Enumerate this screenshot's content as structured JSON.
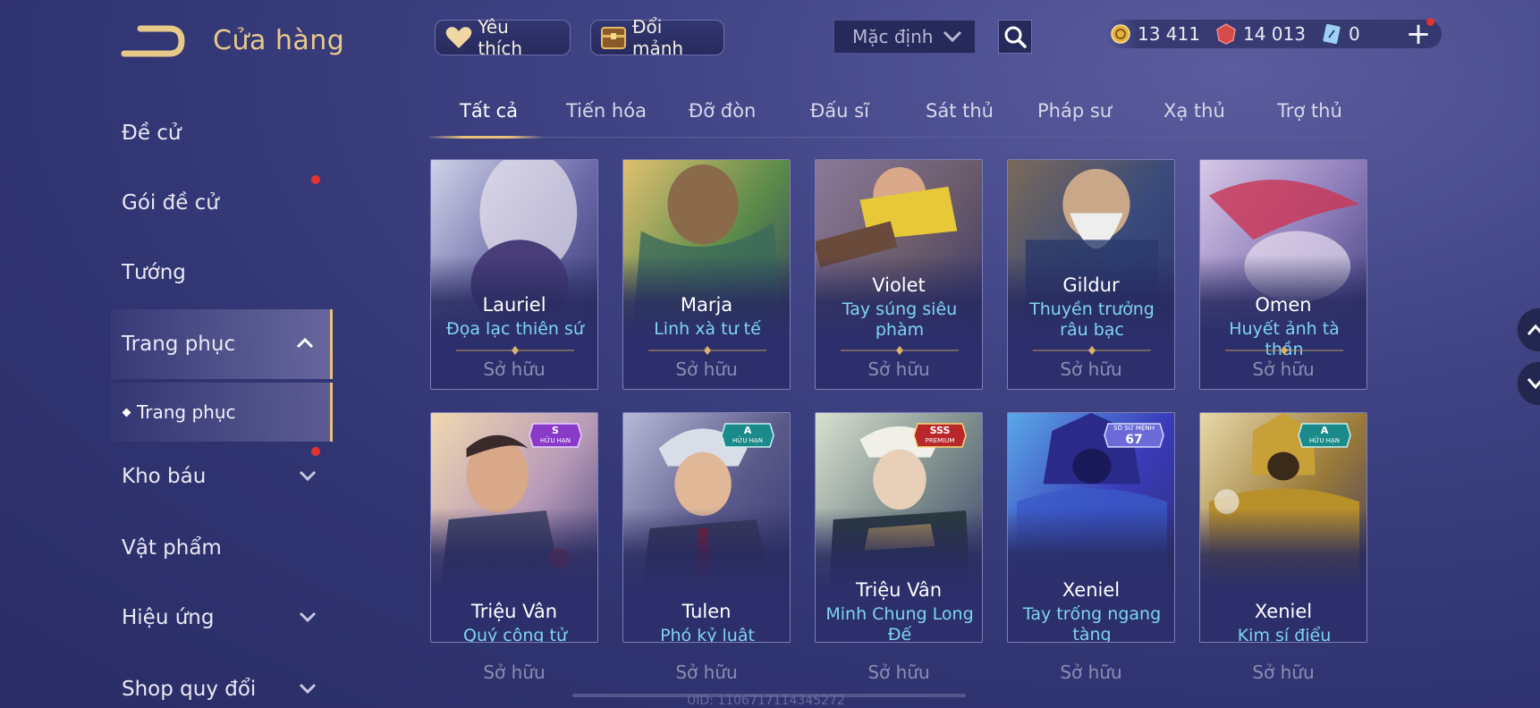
{
  "header": {
    "title": "Cửa hàng",
    "favorite_label": "Yêu thích",
    "exchange_label": "Đổi mảnh",
    "sort": {
      "selected": "Mặc định"
    },
    "currencies": [
      {
        "icon": "gold-coin-icon",
        "value": "13 411"
      },
      {
        "icon": "ruby-gem-icon",
        "value": "14 013"
      },
      {
        "icon": "voucher-icon",
        "value": "0"
      }
    ],
    "add_label": "+"
  },
  "sidebar": {
    "items": [
      {
        "label": "Đề cử"
      },
      {
        "label": "Gói đề cử"
      },
      {
        "label": "Tướng"
      },
      {
        "label": "Trang phục"
      },
      {
        "label": "Kho báu"
      },
      {
        "label": "Vật phẩm"
      },
      {
        "label": "Hiệu ứng"
      },
      {
        "label": "Shop quy đổi"
      }
    ],
    "sub_item": "Trang phục"
  },
  "tabs": [
    "Tất cả",
    "Tiến hóa",
    "Đỡ đòn",
    "Đấu sĩ",
    "Sát thủ",
    "Pháp sư",
    "Xạ thủ",
    "Trợ thủ"
  ],
  "cards": [
    {
      "hero": "Lauriel",
      "skin": "Đọa lạc thiên sứ",
      "status": "Sở hữu"
    },
    {
      "hero": "Marja",
      "skin": "Linh xà tư tế",
      "status": "Sở hữu"
    },
    {
      "hero": "Violet",
      "skin": "Tay súng siêu phàm",
      "status": "Sở hữu"
    },
    {
      "hero": "Gildur",
      "skin": "Thuyền trưởng râu bạc",
      "status": "Sở hữu"
    },
    {
      "hero": "Omen",
      "skin": "Huyết ảnh tà thần",
      "status": "Sở hữu"
    },
    {
      "hero": "Triệu Vân",
      "skin": "Quý công tử",
      "status": "Sở hữu",
      "badge": {
        "rank": "S",
        "sub": "HỮU HẠN"
      }
    },
    {
      "hero": "Tulen",
      "skin": "Phó kỷ luật",
      "status": "Sở hữu",
      "badge": {
        "rank": "A",
        "sub": "HỮU HẠN"
      }
    },
    {
      "hero": "Triệu Vân",
      "skin": "Minh Chung Long Đế",
      "status": "Sở hữu",
      "badge": {
        "rank": "SSS",
        "sub": "PREMIUM"
      }
    },
    {
      "hero": "Xeniel",
      "skin": "Tay trống ngang tàng",
      "status": "Sở hữu",
      "badge": {
        "rank": "67",
        "sub": "SỐ SỨ MỆNH"
      }
    },
    {
      "hero": "Xeniel",
      "skin": "Kim sí điểu",
      "status": "Sở hữu",
      "badge": {
        "rank": "A",
        "sub": "HỮU HẠN"
      }
    }
  ],
  "footer": {
    "uid": "UID: 1106717114345272"
  },
  "colors": {
    "accent": "#e9c98a",
    "skin_text": "#7fd4f2",
    "background": "#3f4384",
    "notify": "#e4322c"
  }
}
